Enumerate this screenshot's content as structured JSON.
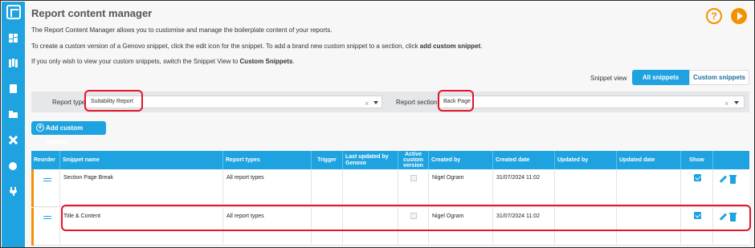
{
  "page": {
    "title": "Report content manager",
    "intro_line1": "The Report Content Manager allows you to customise and manage the boilerplate content of your reports.",
    "intro_line2_prefix": "To create a custom version of a Genovo snippet, click the edit icon for the snippet. To add a brand new custom snippet to a section, click ",
    "intro_line2_bold": "add custom snippet",
    "intro_line2_suffix": ".",
    "intro_line3_prefix": "If you only wish to view your custom snippets, switch the Snippet View to ",
    "intro_line3_bold": "Custom Snippets",
    "intro_line3_suffix": "."
  },
  "header_actions": {
    "help_glyph": "?",
    "help_icon": "help-circle-icon",
    "play_icon": "play-icon"
  },
  "sidebar": {
    "items": [
      {
        "icon": "dashboard-icon"
      },
      {
        "icon": "map-icon"
      },
      {
        "icon": "document-icon"
      },
      {
        "icon": "folder-icon"
      },
      {
        "icon": "tools-icon"
      },
      {
        "icon": "settings-icon"
      },
      {
        "icon": "plug-icon"
      }
    ]
  },
  "snippet_view": {
    "label": "Snippet view",
    "options": [
      "All snippets",
      "Custom snippets"
    ],
    "selected": "All snippets"
  },
  "filters": {
    "report_type_label": "Report type",
    "report_type_value": "Suitability Report",
    "report_section_label": "Report section",
    "report_section_value": "Back Page",
    "clear_glyph": "×"
  },
  "add_button": {
    "label": "Add custom snippet",
    "glyph": "+"
  },
  "table": {
    "columns": [
      "Reorder",
      "Snippet name",
      "Report types",
      "Trigger",
      "Last updated by Genovo",
      "Active custom version",
      "Created by",
      "Created date",
      "Updated by",
      "Updated date",
      "Show",
      ""
    ],
    "rows": [
      {
        "snippet_name": "Section Page Break",
        "report_types": "All report types",
        "trigger": "",
        "last_updated": "",
        "active_custom": false,
        "created_by": "Nigel Ogram",
        "created_date": "31/07/2024 11:02",
        "updated_by": "",
        "updated_date": "",
        "show": true
      },
      {
        "snippet_name": "Title & Content",
        "report_types": "All report types",
        "trigger": "",
        "last_updated": "",
        "active_custom": false,
        "created_by": "Nigel Ogram",
        "created_date": "31/07/2024 11:02",
        "updated_by": "",
        "updated_date": "",
        "show": true
      }
    ]
  },
  "colors": {
    "accent": "#1ea3e0",
    "orange": "#f39200",
    "highlight": "#e3152b"
  }
}
